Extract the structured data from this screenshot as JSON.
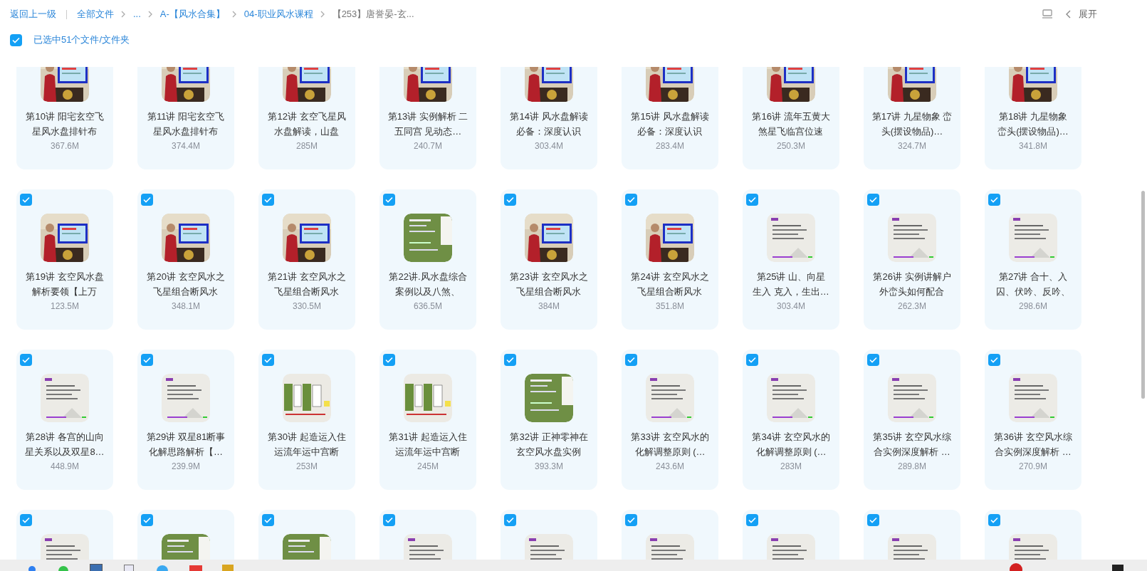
{
  "breadcrumb": {
    "back": "返回上一级",
    "items": [
      {
        "label": "全部文件",
        "current": false
      },
      {
        "label": "...",
        "current": false
      },
      {
        "label": "A-【风水合集】",
        "current": false
      },
      {
        "label": "04-职业风水课程",
        "current": false
      },
      {
        "label": "【253】唐誉晏-玄...",
        "current": true
      }
    ]
  },
  "toolbar": {
    "expand": "展开"
  },
  "selection": {
    "checked": true,
    "label": "已选中51个文件/文件夹"
  },
  "files": [
    {
      "title_lines": [
        "第10讲 阳宅玄空飞",
        "星风水盘排针布"
      ],
      "size": "367.6M"
    },
    {
      "title_lines": [
        "第11讲 阳宅玄空飞",
        "星风水盘排针布"
      ],
      "size": "374.4M"
    },
    {
      "title_lines": [
        "第12讲 玄空飞星风",
        "水盘解读，山盘"
      ],
      "size": "285M"
    },
    {
      "title_lines": [
        "第13讲 实例解析 二",
        "五同宫 见动态…"
      ],
      "size": "240.7M"
    },
    {
      "title_lines": [
        "第14讲 风水盘解读",
        "必备：深度认识"
      ],
      "size": "303.4M"
    },
    {
      "title_lines": [
        "第15讲 风水盘解读",
        "必备：深度认识"
      ],
      "size": "283.4M"
    },
    {
      "title_lines": [
        "第16讲 流年五黄大",
        "煞星飞临宫位速"
      ],
      "size": "250.3M"
    },
    {
      "title_lines": [
        "第17讲 九星物象 峦",
        "头(摆设物品)…"
      ],
      "size": "324.7M"
    },
    {
      "title_lines": [
        "第18讲 九星物象",
        "峦头(摆设物品)…"
      ],
      "size": "341.8M"
    },
    {
      "checked": true,
      "title_lines": [
        "第19讲 玄空风水盘",
        "解析要领【上万"
      ],
      "size": "123.5M"
    },
    {
      "checked": true,
      "title_lines": [
        "第20讲 玄空风水之",
        "飞星组合断风水"
      ],
      "size": "348.1M"
    },
    {
      "checked": true,
      "title_lines": [
        "第21讲 玄空风水之",
        "飞星组合断风水"
      ],
      "size": "330.5M"
    },
    {
      "checked": true,
      "title_lines": [
        "第22讲.风水盘综合",
        "案例以及八煞、"
      ],
      "size": "636.5M"
    },
    {
      "checked": true,
      "title_lines": [
        "第23讲 玄空风水之",
        "飞星组合断风水"
      ],
      "size": "384M"
    },
    {
      "checked": true,
      "title_lines": [
        "第24讲 玄空风水之",
        "飞星组合断风水"
      ],
      "size": "351.8M"
    },
    {
      "checked": true,
      "title_lines": [
        "第25讲 山、向星",
        "生入 克入，生出…"
      ],
      "size": "303.4M"
    },
    {
      "checked": true,
      "title_lines": [
        "第26讲 实例讲解户",
        "外峦头如何配合"
      ],
      "size": "262.3M"
    },
    {
      "checked": true,
      "title_lines": [
        "第27讲 合十、入",
        "囚、伏吟、反吟、"
      ],
      "size": "298.6M"
    },
    {
      "checked": true,
      "title_lines": [
        "第28讲 各宫的山向",
        "星关系以及双星8…"
      ],
      "size": "448.9M"
    },
    {
      "checked": true,
      "title_lines": [
        "第29讲 双星81断事",
        "化解思路解析【…"
      ],
      "size": "239.9M"
    },
    {
      "checked": true,
      "title_lines": [
        "第30讲 起造运入住",
        "运流年运中宫断"
      ],
      "size": "253M"
    },
    {
      "checked": true,
      "title_lines": [
        "第31讲 起造运入住",
        "运流年运中宫断"
      ],
      "size": "245M"
    },
    {
      "checked": true,
      "title_lines": [
        "第32讲 正神零神在",
        "玄空风水盘实例"
      ],
      "size": "393.3M"
    },
    {
      "checked": true,
      "title_lines": [
        "第33讲 玄空风水的",
        "化解调整原则 (…"
      ],
      "size": "243.6M"
    },
    {
      "checked": true,
      "title_lines": [
        "第34讲 玄空风水的",
        "化解调整原则 (…"
      ],
      "size": "283M"
    },
    {
      "checked": true,
      "title_lines": [
        "第35讲 玄空风水综",
        "合实例深度解析 …"
      ],
      "size": "289.8M"
    },
    {
      "checked": true,
      "title_lines": [
        "第36讲 玄空风水综",
        "合实例深度解析 …"
      ],
      "size": "270.9M"
    },
    {
      "checked": true
    },
    {
      "checked": true
    },
    {
      "checked": true
    },
    {
      "checked": true
    },
    {
      "checked": true
    },
    {
      "checked": true
    },
    {
      "checked": true
    },
    {
      "checked": true
    },
    {
      "checked": true
    }
  ]
}
